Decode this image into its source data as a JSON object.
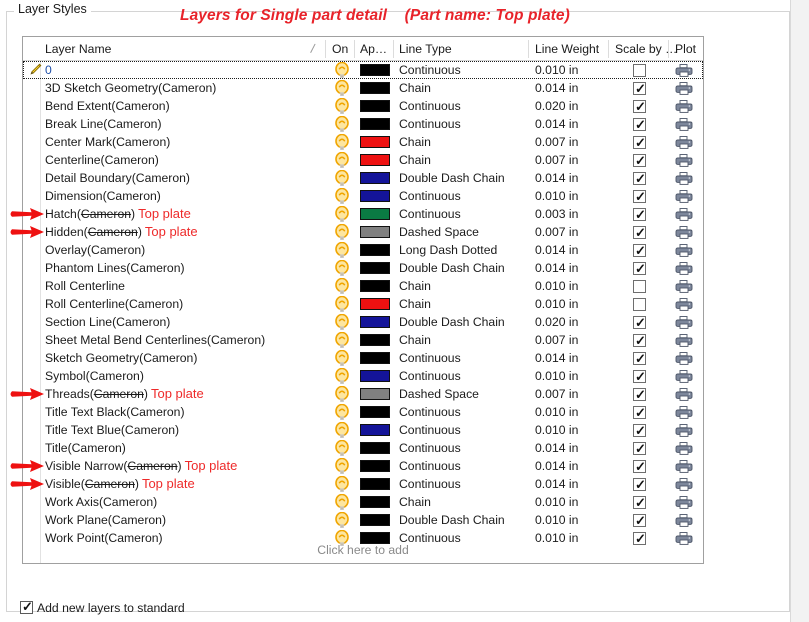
{
  "group": {
    "legend": "Layer Styles"
  },
  "annotation": {
    "title": "Layers for Single part detail    (Part name: Top plate)",
    "replacement_text": "Top plate",
    "struck_text": "Cameron",
    "color": "#ee2a2a"
  },
  "table": {
    "headers": {
      "layer_name": "Layer Name",
      "on": "On",
      "appearance": "Ap…",
      "line_type": "Line Type",
      "line_weight": "Line Weight",
      "scale_by": "Scale by …",
      "plot": "Plot"
    },
    "add_row_label": "Click here to add",
    "rows": [
      {
        "name": "0",
        "suffix": "",
        "on": true,
        "color": "#000000",
        "line_type": "Continuous",
        "line_weight": "0.010 in",
        "scale_by": false,
        "plot": true,
        "selected": true,
        "editing": true,
        "annotated": false
      },
      {
        "name": "3D Sketch Geometry",
        "suffix": "(Cameron)",
        "on": true,
        "color": "#000000",
        "line_type": "Chain",
        "line_weight": "0.014 in",
        "scale_by": true,
        "plot": true,
        "selected": false,
        "editing": false,
        "annotated": false
      },
      {
        "name": "Bend Extent",
        "suffix": "(Cameron)",
        "on": true,
        "color": "#000000",
        "line_type": "Continuous",
        "line_weight": "0.020 in",
        "scale_by": true,
        "plot": true,
        "selected": false,
        "editing": false,
        "annotated": false
      },
      {
        "name": "Break Line",
        "suffix": "(Cameron)",
        "on": true,
        "color": "#000000",
        "line_type": "Continuous",
        "line_weight": "0.014 in",
        "scale_by": true,
        "plot": true,
        "selected": false,
        "editing": false,
        "annotated": false
      },
      {
        "name": "Center Mark",
        "suffix": "(Cameron)",
        "on": true,
        "color": "#ee1111",
        "line_type": "Chain",
        "line_weight": "0.007 in",
        "scale_by": true,
        "plot": true,
        "selected": false,
        "editing": false,
        "annotated": false
      },
      {
        "name": "Centerline",
        "suffix": "(Cameron)",
        "on": true,
        "color": "#ee1111",
        "line_type": "Chain",
        "line_weight": "0.007 in",
        "scale_by": true,
        "plot": true,
        "selected": false,
        "editing": false,
        "annotated": false
      },
      {
        "name": "Detail Boundary",
        "suffix": "(Cameron)",
        "on": true,
        "color": "#141499",
        "line_type": "Double Dash Chain",
        "line_weight": "0.014 in",
        "scale_by": true,
        "plot": true,
        "selected": false,
        "editing": false,
        "annotated": false
      },
      {
        "name": "Dimension",
        "suffix": "(Cameron)",
        "on": true,
        "color": "#141499",
        "line_type": "Continuous",
        "line_weight": "0.010 in",
        "scale_by": true,
        "plot": true,
        "selected": false,
        "editing": false,
        "annotated": false
      },
      {
        "name": "Hatch",
        "suffix": "(Cameron)",
        "on": true,
        "color": "#0a7a43",
        "line_type": "Continuous",
        "line_weight": "0.003 in",
        "scale_by": true,
        "plot": true,
        "selected": false,
        "editing": false,
        "annotated": true
      },
      {
        "name": "Hidden",
        "suffix": "(Cameron)",
        "on": true,
        "color": "#808080",
        "line_type": "Dashed Space",
        "line_weight": "0.007 in",
        "scale_by": true,
        "plot": true,
        "selected": false,
        "editing": false,
        "annotated": true
      },
      {
        "name": "Overlay",
        "suffix": "(Cameron)",
        "on": true,
        "color": "#000000",
        "line_type": "Long Dash Dotted",
        "line_weight": "0.014 in",
        "scale_by": true,
        "plot": true,
        "selected": false,
        "editing": false,
        "annotated": false
      },
      {
        "name": "Phantom Lines",
        "suffix": "(Cameron)",
        "on": true,
        "color": "#000000",
        "line_type": "Double Dash Chain",
        "line_weight": "0.014 in",
        "scale_by": true,
        "plot": true,
        "selected": false,
        "editing": false,
        "annotated": false
      },
      {
        "name": "Roll Centerline",
        "suffix": "",
        "on": true,
        "color": "#000000",
        "line_type": "Chain",
        "line_weight": "0.010 in",
        "scale_by": false,
        "plot": true,
        "selected": false,
        "editing": false,
        "annotated": false
      },
      {
        "name": "Roll Centerline",
        "suffix": "(Cameron)",
        "on": true,
        "color": "#ee1111",
        "line_type": "Chain",
        "line_weight": "0.010 in",
        "scale_by": false,
        "plot": true,
        "selected": false,
        "editing": false,
        "annotated": false
      },
      {
        "name": "Section Line",
        "suffix": "(Cameron)",
        "on": true,
        "color": "#141499",
        "line_type": "Double Dash Chain",
        "line_weight": "0.020 in",
        "scale_by": true,
        "plot": true,
        "selected": false,
        "editing": false,
        "annotated": false
      },
      {
        "name": "Sheet Metal Bend Centerlines",
        "suffix": "(Cameron)",
        "on": true,
        "color": "#000000",
        "line_type": "Chain",
        "line_weight": "0.007 in",
        "scale_by": true,
        "plot": true,
        "selected": false,
        "editing": false,
        "annotated": false
      },
      {
        "name": "Sketch Geometry",
        "suffix": "(Cameron)",
        "on": true,
        "color": "#000000",
        "line_type": "Continuous",
        "line_weight": "0.014 in",
        "scale_by": true,
        "plot": true,
        "selected": false,
        "editing": false,
        "annotated": false
      },
      {
        "name": "Symbol",
        "suffix": "(Cameron)",
        "on": true,
        "color": "#141499",
        "line_type": "Continuous",
        "line_weight": "0.010 in",
        "scale_by": true,
        "plot": true,
        "selected": false,
        "editing": false,
        "annotated": false
      },
      {
        "name": "Threads",
        "suffix": "(Cameron)",
        "on": true,
        "color": "#808080",
        "line_type": "Dashed Space",
        "line_weight": "0.007 in",
        "scale_by": true,
        "plot": true,
        "selected": false,
        "editing": false,
        "annotated": true
      },
      {
        "name": "Title Text Black",
        "suffix": "(Cameron)",
        "on": true,
        "color": "#000000",
        "line_type": "Continuous",
        "line_weight": "0.010 in",
        "scale_by": true,
        "plot": true,
        "selected": false,
        "editing": false,
        "annotated": false
      },
      {
        "name": "Title Text Blue",
        "suffix": "(Cameron)",
        "on": true,
        "color": "#141499",
        "line_type": "Continuous",
        "line_weight": "0.010 in",
        "scale_by": true,
        "plot": true,
        "selected": false,
        "editing": false,
        "annotated": false
      },
      {
        "name": "Title",
        "suffix": "(Cameron)",
        "on": true,
        "color": "#000000",
        "line_type": "Continuous",
        "line_weight": "0.014 in",
        "scale_by": true,
        "plot": true,
        "selected": false,
        "editing": false,
        "annotated": false
      },
      {
        "name": "Visible Narrow",
        "suffix": "(Cameron)",
        "on": true,
        "color": "#000000",
        "line_type": "Continuous",
        "line_weight": "0.014 in",
        "scale_by": true,
        "plot": true,
        "selected": false,
        "editing": false,
        "annotated": true
      },
      {
        "name": "Visible",
        "suffix": "(Cameron)",
        "on": true,
        "color": "#000000",
        "line_type": "Continuous",
        "line_weight": "0.014 in",
        "scale_by": true,
        "plot": true,
        "selected": false,
        "editing": false,
        "annotated": true
      },
      {
        "name": "Work Axis",
        "suffix": "(Cameron)",
        "on": true,
        "color": "#000000",
        "line_type": "Chain",
        "line_weight": "0.010 in",
        "scale_by": true,
        "plot": true,
        "selected": false,
        "editing": false,
        "annotated": false
      },
      {
        "name": "Work Plane",
        "suffix": "(Cameron)",
        "on": true,
        "color": "#000000",
        "line_type": "Double Dash Chain",
        "line_weight": "0.010 in",
        "scale_by": true,
        "plot": true,
        "selected": false,
        "editing": false,
        "annotated": false
      },
      {
        "name": "Work Point",
        "suffix": "(Cameron)",
        "on": true,
        "color": "#000000",
        "line_type": "Continuous",
        "line_weight": "0.010 in",
        "scale_by": true,
        "plot": true,
        "selected": false,
        "editing": false,
        "annotated": false
      }
    ]
  },
  "footer": {
    "add_new_layers_label": "Add new layers to standard",
    "add_new_layers_checked": true
  }
}
